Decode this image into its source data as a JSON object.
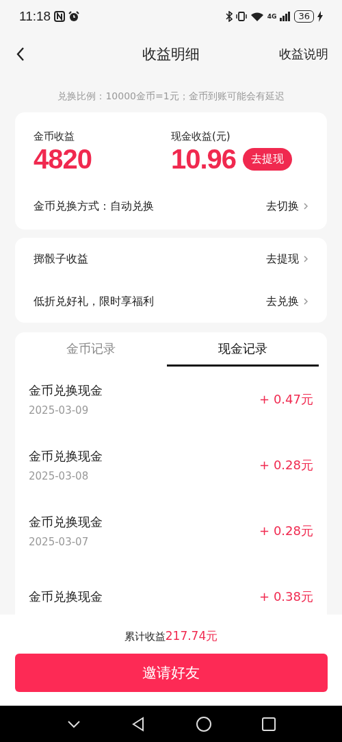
{
  "status_bar": {
    "time": "11:18",
    "network": "4G",
    "battery": "36"
  },
  "header": {
    "title": "收益明细",
    "action": "收益说明"
  },
  "notice": "兑换比例：10000金币=1元；金币到账可能会有延迟",
  "summary": {
    "coins": {
      "label": "金币收益",
      "value": "4820"
    },
    "cash": {
      "label": "现金收益(元)",
      "value": "10.96",
      "button": "去提现"
    },
    "mode": {
      "label": "金币兑换方式：自动兑换",
      "action": "去切换"
    }
  },
  "links": [
    {
      "label": "掷骰子收益",
      "action": "去提现"
    },
    {
      "label": "低折兑好礼，限时享福利",
      "action": "去兑换"
    }
  ],
  "tabs": [
    {
      "label": "金币记录",
      "selected": false
    },
    {
      "label": "现金记录",
      "selected": true
    }
  ],
  "records": [
    {
      "title": "金币兑换现金",
      "date": "2025-03-09",
      "amount": "+ 0.47元"
    },
    {
      "title": "金币兑换现金",
      "date": "2025-03-08",
      "amount": "+ 0.28元"
    },
    {
      "title": "金币兑换现金",
      "date": "2025-03-07",
      "amount": "+ 0.28元"
    },
    {
      "title": "金币兑换现金",
      "amount": "+ 0.38元"
    }
  ],
  "footer": {
    "total_label": "累计收益",
    "total_value": "217.74元",
    "button": "邀请好友"
  }
}
